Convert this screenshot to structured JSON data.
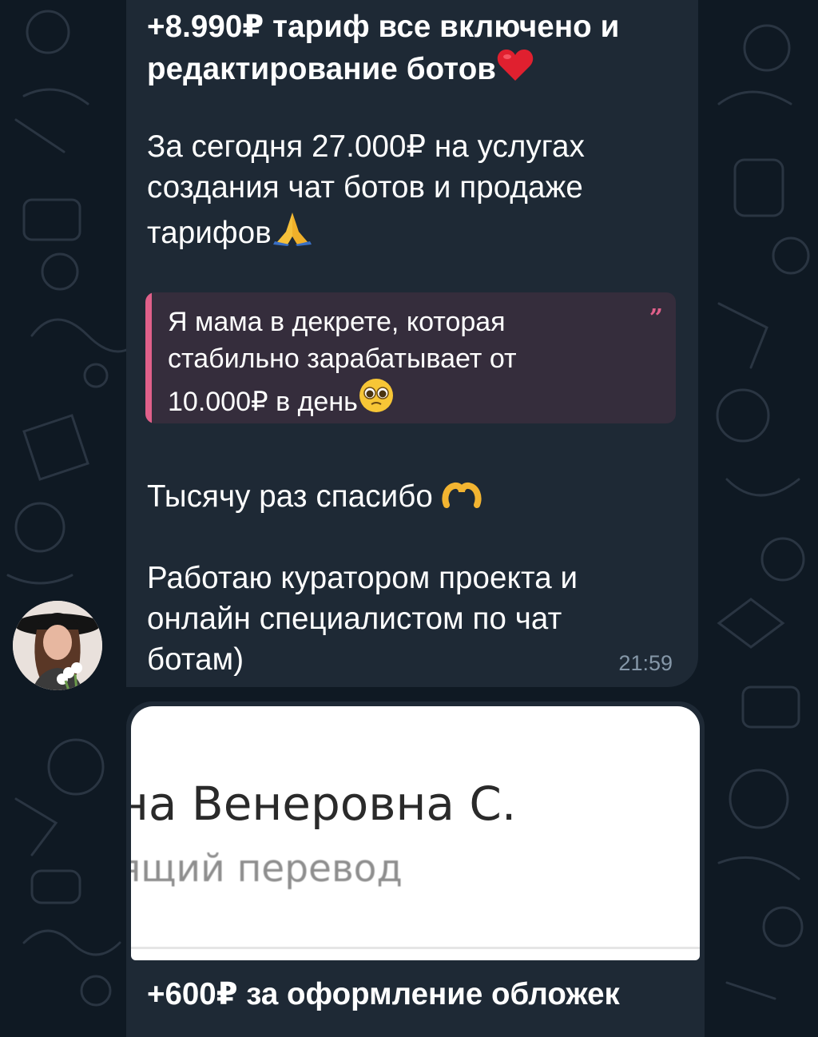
{
  "message1": {
    "line1": "+8.990₽ тариф все включено и",
    "line2": "редактирование ботов",
    "para2_lines": [
      "За сегодня 27.000₽ на услугах",
      "создания чат ботов и продаже"
    ],
    "para2_last": "тарифов",
    "quote_lines": [
      "Я мама в декрете, которая",
      "стабильно зарабатывает от"
    ],
    "quote_last": "10.000₽ в день",
    "thanks": "Тысячу раз спасибо",
    "para4_lines": [
      "Работаю куратором проекта и",
      "онлайн специалистом по чат",
      "ботам)"
    ],
    "time": "21:59"
  },
  "message2": {
    "photo_name": "на Венеровна С.",
    "photo_sub": "ящий перевод",
    "text": "+600₽ за оформление обложек"
  },
  "icons": {
    "heart": "red-heart-icon",
    "pray": "folded-hands-icon",
    "pleading": "pleading-face-icon",
    "heart_hands": "heart-hands-icon",
    "quote": "quote-icon"
  },
  "colors": {
    "background": "#0f1923",
    "bubble": "#1e2935",
    "quote_bg": "#352d3c",
    "quote_accent": "#e0608a",
    "time": "#8597a8"
  }
}
